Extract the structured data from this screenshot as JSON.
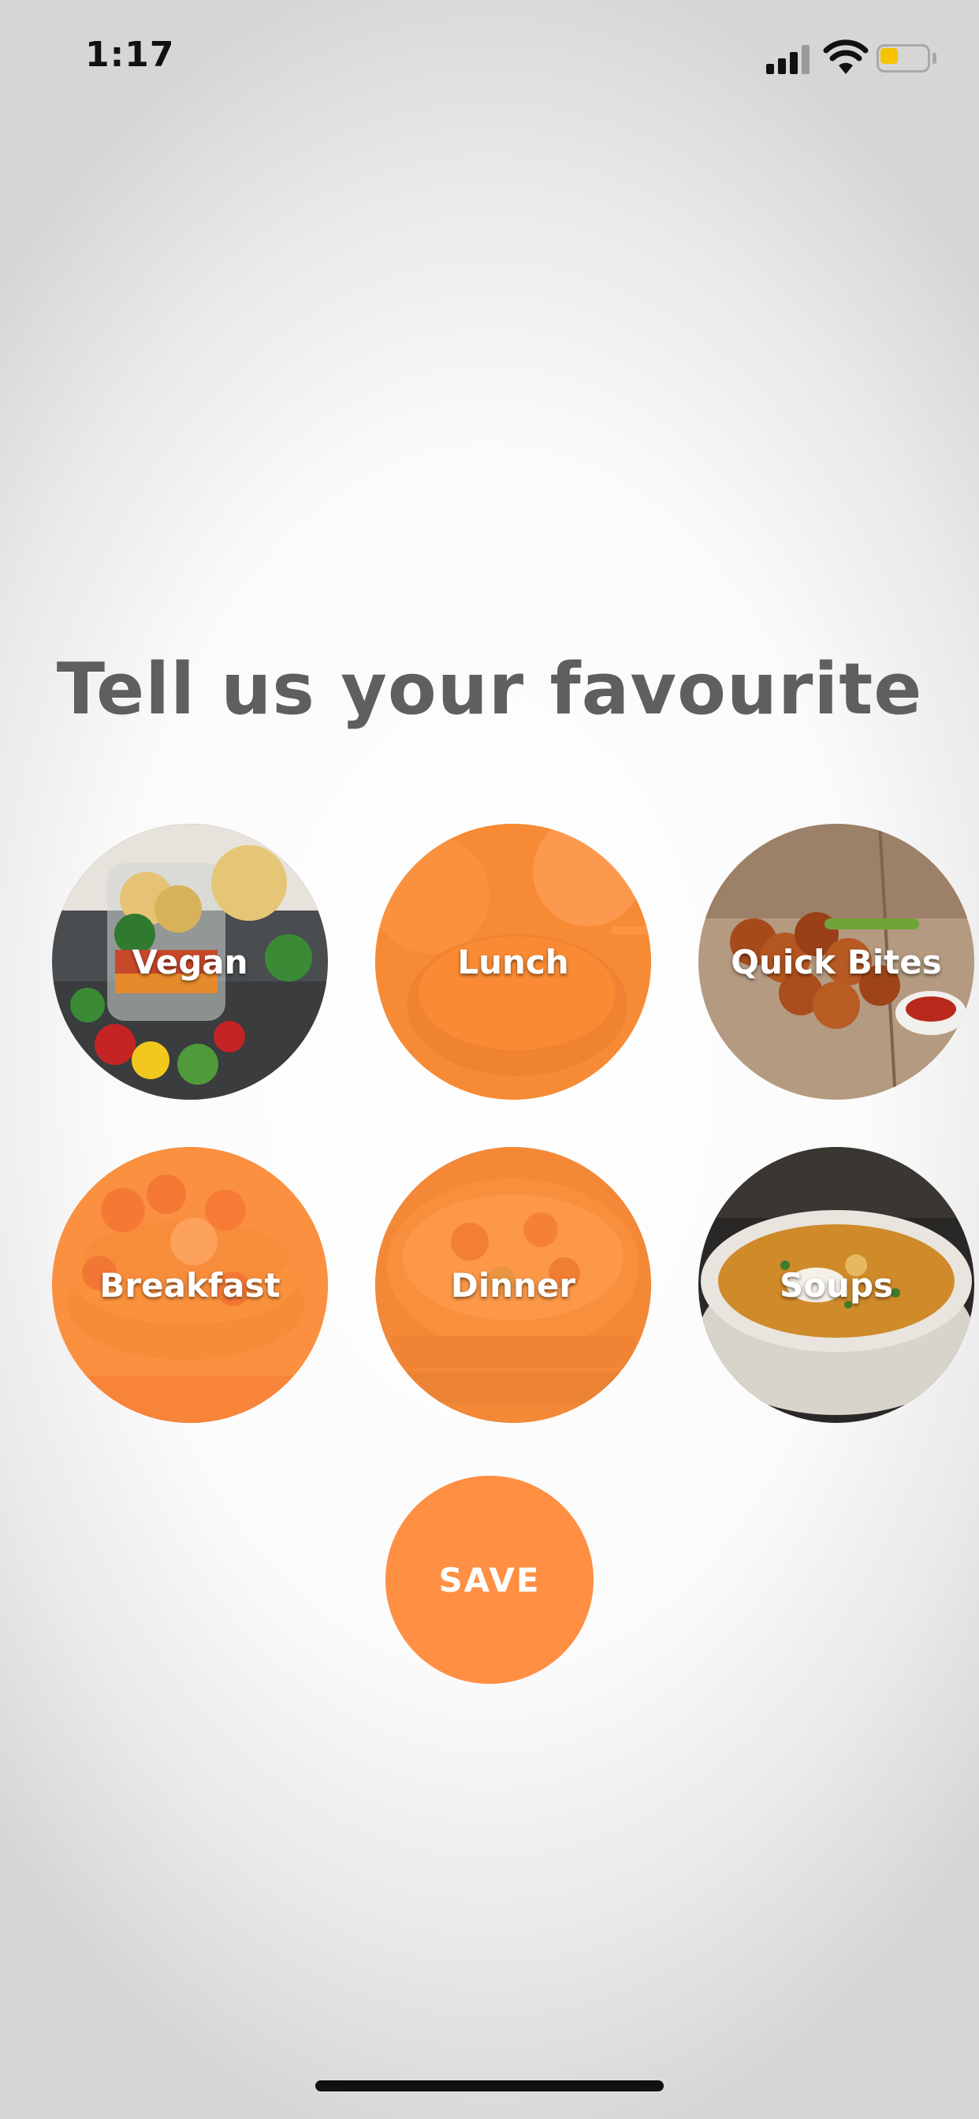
{
  "status_bar": {
    "time": "1:17",
    "icons": [
      "cellular-signal-icon",
      "wifi-icon",
      "battery-icon"
    ],
    "battery_color": "#f5c400"
  },
  "title": "Tell us your favourite",
  "categories": [
    {
      "label": "Vegan",
      "selected": false
    },
    {
      "label": "Lunch",
      "selected": true
    },
    {
      "label": "Quick Bites",
      "selected": false
    },
    {
      "label": "Breakfast",
      "selected": true
    },
    {
      "label": "Dinner",
      "selected": true
    },
    {
      "label": "Soups",
      "selected": false
    }
  ],
  "save_label": "SAVE",
  "colors": {
    "accent": "#ff8f42",
    "title": "#5f5f5f"
  }
}
